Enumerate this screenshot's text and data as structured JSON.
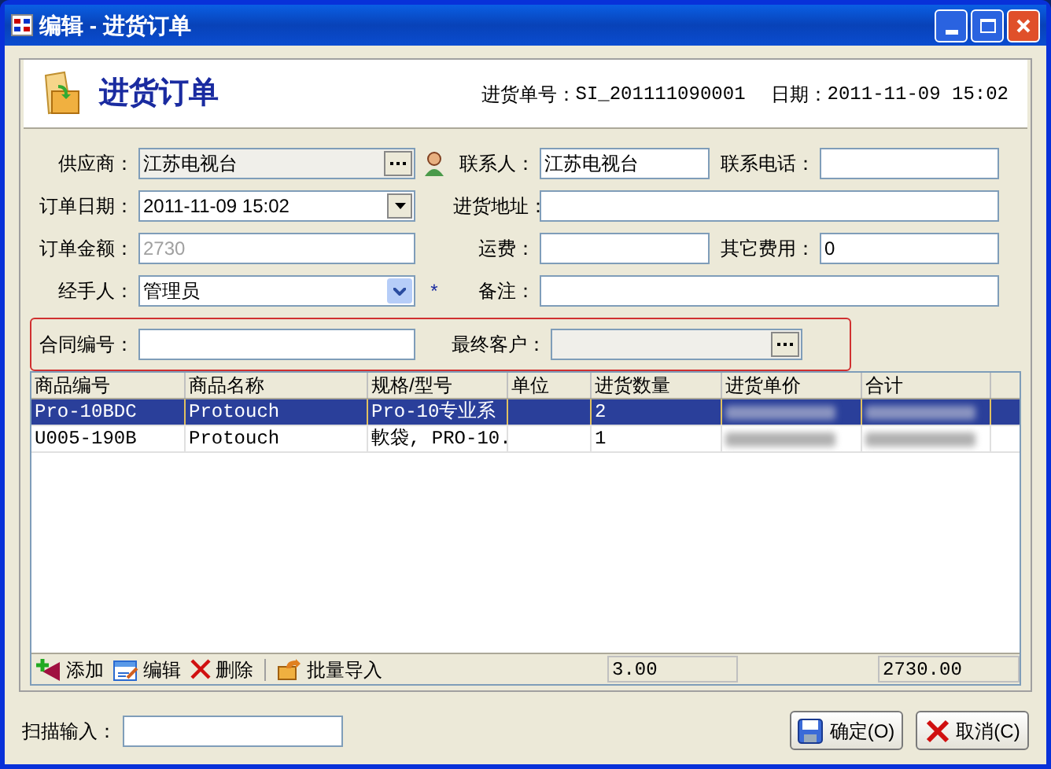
{
  "window": {
    "title": "编辑 - 进货订单"
  },
  "header": {
    "title": "进货订单",
    "order_no_label": "进货单号：",
    "order_no": "SI_201111090001",
    "date_label": "日期：",
    "date": "2011-11-09 15:02"
  },
  "form": {
    "rows": [
      [
        {
          "label": "供应商：",
          "value": "江苏电视台",
          "kind": "lookup"
        },
        {
          "label": "联系人：",
          "value": "江苏电视台",
          "kind": "text"
        },
        {
          "label": "联系电话：",
          "kind": "text"
        }
      ],
      [
        {
          "label": "订单日期：",
          "value": "2011-11-09 15:02",
          "kind": "date"
        },
        {
          "label": "进货地址：",
          "kind": "text"
        }
      ],
      [
        {
          "label": "订单金额：",
          "value": "2730",
          "kind": "readonly"
        },
        {
          "label": "运费：",
          "kind": "text"
        },
        {
          "label": "其它费用：",
          "value": "0",
          "kind": "text"
        }
      ],
      [
        {
          "label": "经手人：",
          "value": "管理员",
          "kind": "select",
          "required_mark": "*"
        },
        {
          "label": "备注：",
          "kind": "text"
        }
      ]
    ],
    "extra_row": [
      {
        "label": "合同编号：",
        "kind": "text"
      },
      {
        "label": "最终客户：",
        "kind": "lookup"
      }
    ]
  },
  "table": {
    "columns": [
      "商品编号",
      "商品名称",
      "规格/型号",
      "单位",
      "进货数量",
      "进货单价",
      "合计"
    ],
    "rows": [
      {
        "cells": [
          "Pro-10BDC",
          "Protouch",
          "Pro-10专业系",
          "",
          "2"
        ],
        "selected": true
      },
      {
        "cells": [
          "U005-190B",
          "Protouch",
          "軟袋, PRO-10.",
          "",
          "1"
        ],
        "selected": false
      }
    ]
  },
  "toolbar": [
    {
      "label": "添加",
      "kind": "add"
    },
    {
      "label": "编辑",
      "kind": "edit"
    },
    {
      "label": "删除",
      "kind": "delete"
    },
    {
      "label": "批量导入",
      "kind": "import"
    }
  ],
  "totals": {
    "quantity": "3.00",
    "total": "2730.00"
  },
  "scan": {
    "label": "扫描输入："
  },
  "buttons": [
    {
      "label": "确定(O)",
      "kind": "ok"
    },
    {
      "label": "取消(C)",
      "kind": "cancel"
    }
  ]
}
